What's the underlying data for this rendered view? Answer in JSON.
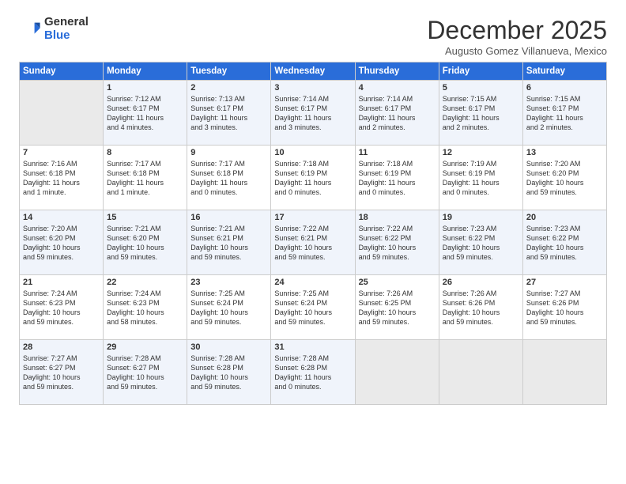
{
  "logo": {
    "general": "General",
    "blue": "Blue"
  },
  "header": {
    "month": "December 2025",
    "location": "Augusto Gomez Villanueva, Mexico"
  },
  "weekdays": [
    "Sunday",
    "Monday",
    "Tuesday",
    "Wednesday",
    "Thursday",
    "Friday",
    "Saturday"
  ],
  "weeks": [
    [
      {
        "day": "",
        "info": ""
      },
      {
        "day": "1",
        "info": "Sunrise: 7:12 AM\nSunset: 6:17 PM\nDaylight: 11 hours\nand 4 minutes."
      },
      {
        "day": "2",
        "info": "Sunrise: 7:13 AM\nSunset: 6:17 PM\nDaylight: 11 hours\nand 3 minutes."
      },
      {
        "day": "3",
        "info": "Sunrise: 7:14 AM\nSunset: 6:17 PM\nDaylight: 11 hours\nand 3 minutes."
      },
      {
        "day": "4",
        "info": "Sunrise: 7:14 AM\nSunset: 6:17 PM\nDaylight: 11 hours\nand 2 minutes."
      },
      {
        "day": "5",
        "info": "Sunrise: 7:15 AM\nSunset: 6:17 PM\nDaylight: 11 hours\nand 2 minutes."
      },
      {
        "day": "6",
        "info": "Sunrise: 7:15 AM\nSunset: 6:17 PM\nDaylight: 11 hours\nand 2 minutes."
      }
    ],
    [
      {
        "day": "7",
        "info": "Sunrise: 7:16 AM\nSunset: 6:18 PM\nDaylight: 11 hours\nand 1 minute."
      },
      {
        "day": "8",
        "info": "Sunrise: 7:17 AM\nSunset: 6:18 PM\nDaylight: 11 hours\nand 1 minute."
      },
      {
        "day": "9",
        "info": "Sunrise: 7:17 AM\nSunset: 6:18 PM\nDaylight: 11 hours\nand 0 minutes."
      },
      {
        "day": "10",
        "info": "Sunrise: 7:18 AM\nSunset: 6:19 PM\nDaylight: 11 hours\nand 0 minutes."
      },
      {
        "day": "11",
        "info": "Sunrise: 7:18 AM\nSunset: 6:19 PM\nDaylight: 11 hours\nand 0 minutes."
      },
      {
        "day": "12",
        "info": "Sunrise: 7:19 AM\nSunset: 6:19 PM\nDaylight: 11 hours\nand 0 minutes."
      },
      {
        "day": "13",
        "info": "Sunrise: 7:20 AM\nSunset: 6:20 PM\nDaylight: 10 hours\nand 59 minutes."
      }
    ],
    [
      {
        "day": "14",
        "info": "Sunrise: 7:20 AM\nSunset: 6:20 PM\nDaylight: 10 hours\nand 59 minutes."
      },
      {
        "day": "15",
        "info": "Sunrise: 7:21 AM\nSunset: 6:20 PM\nDaylight: 10 hours\nand 59 minutes."
      },
      {
        "day": "16",
        "info": "Sunrise: 7:21 AM\nSunset: 6:21 PM\nDaylight: 10 hours\nand 59 minutes."
      },
      {
        "day": "17",
        "info": "Sunrise: 7:22 AM\nSunset: 6:21 PM\nDaylight: 10 hours\nand 59 minutes."
      },
      {
        "day": "18",
        "info": "Sunrise: 7:22 AM\nSunset: 6:22 PM\nDaylight: 10 hours\nand 59 minutes."
      },
      {
        "day": "19",
        "info": "Sunrise: 7:23 AM\nSunset: 6:22 PM\nDaylight: 10 hours\nand 59 minutes."
      },
      {
        "day": "20",
        "info": "Sunrise: 7:23 AM\nSunset: 6:22 PM\nDaylight: 10 hours\nand 59 minutes."
      }
    ],
    [
      {
        "day": "21",
        "info": "Sunrise: 7:24 AM\nSunset: 6:23 PM\nDaylight: 10 hours\nand 59 minutes."
      },
      {
        "day": "22",
        "info": "Sunrise: 7:24 AM\nSunset: 6:23 PM\nDaylight: 10 hours\nand 58 minutes."
      },
      {
        "day": "23",
        "info": "Sunrise: 7:25 AM\nSunset: 6:24 PM\nDaylight: 10 hours\nand 59 minutes."
      },
      {
        "day": "24",
        "info": "Sunrise: 7:25 AM\nSunset: 6:24 PM\nDaylight: 10 hours\nand 59 minutes."
      },
      {
        "day": "25",
        "info": "Sunrise: 7:26 AM\nSunset: 6:25 PM\nDaylight: 10 hours\nand 59 minutes."
      },
      {
        "day": "26",
        "info": "Sunrise: 7:26 AM\nSunset: 6:26 PM\nDaylight: 10 hours\nand 59 minutes."
      },
      {
        "day": "27",
        "info": "Sunrise: 7:27 AM\nSunset: 6:26 PM\nDaylight: 10 hours\nand 59 minutes."
      }
    ],
    [
      {
        "day": "28",
        "info": "Sunrise: 7:27 AM\nSunset: 6:27 PM\nDaylight: 10 hours\nand 59 minutes."
      },
      {
        "day": "29",
        "info": "Sunrise: 7:28 AM\nSunset: 6:27 PM\nDaylight: 10 hours\nand 59 minutes."
      },
      {
        "day": "30",
        "info": "Sunrise: 7:28 AM\nSunset: 6:28 PM\nDaylight: 10 hours\nand 59 minutes."
      },
      {
        "day": "31",
        "info": "Sunrise: 7:28 AM\nSunset: 6:28 PM\nDaylight: 11 hours\nand 0 minutes."
      },
      {
        "day": "",
        "info": ""
      },
      {
        "day": "",
        "info": ""
      },
      {
        "day": "",
        "info": ""
      }
    ]
  ]
}
